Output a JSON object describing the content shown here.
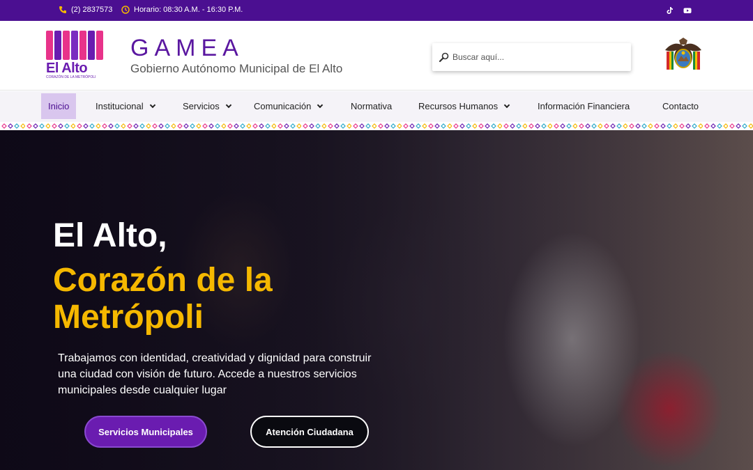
{
  "topbar": {
    "phone": "(2) 2837573",
    "hours": "Horario: 08:30 A.M. - 16:30 P.M.",
    "bg_color": "#4b0f91",
    "social_icons": [
      "tiktok-icon",
      "youtube-icon"
    ]
  },
  "header": {
    "logo_word": "El Alto",
    "logo_tagline": "CORAZÓN DE LA METRÓPOLI",
    "brand_title": "GAMEA",
    "brand_subtitle": "Gobierno Autónomo Municipal de El Alto",
    "search_placeholder": "Buscar aquí..."
  },
  "nav": {
    "items": [
      {
        "label": "Inicio",
        "active": true,
        "dropdown": false
      },
      {
        "label": "Institucional",
        "active": false,
        "dropdown": true
      },
      {
        "label": "Servicios",
        "active": false,
        "dropdown": true
      },
      {
        "label": "Comunicación",
        "active": false,
        "dropdown": true
      },
      {
        "label": "Normativa",
        "active": false,
        "dropdown": false
      },
      {
        "label": "Recursos Humanos",
        "active": false,
        "dropdown": true
      },
      {
        "label": "Información Financiera",
        "active": false,
        "dropdown": false
      },
      {
        "label": "Contacto",
        "active": false,
        "dropdown": false
      }
    ]
  },
  "hero": {
    "title": "El Alto,",
    "subtitle": "Corazón de la Metrópoli",
    "description": "Trabajamos con identidad, creatividad y dignidad para construir una ciudad con visión de futuro. Accede a nuestros servicios municipales desde cualquier lugar",
    "primary_button": "Servicios Municipales",
    "secondary_button": "Atención Ciudadana",
    "accent_color": "#f5b800"
  },
  "colors": {
    "brand_purple": "#6a1cb0",
    "nav_active_bg": "#d9c6ee"
  }
}
